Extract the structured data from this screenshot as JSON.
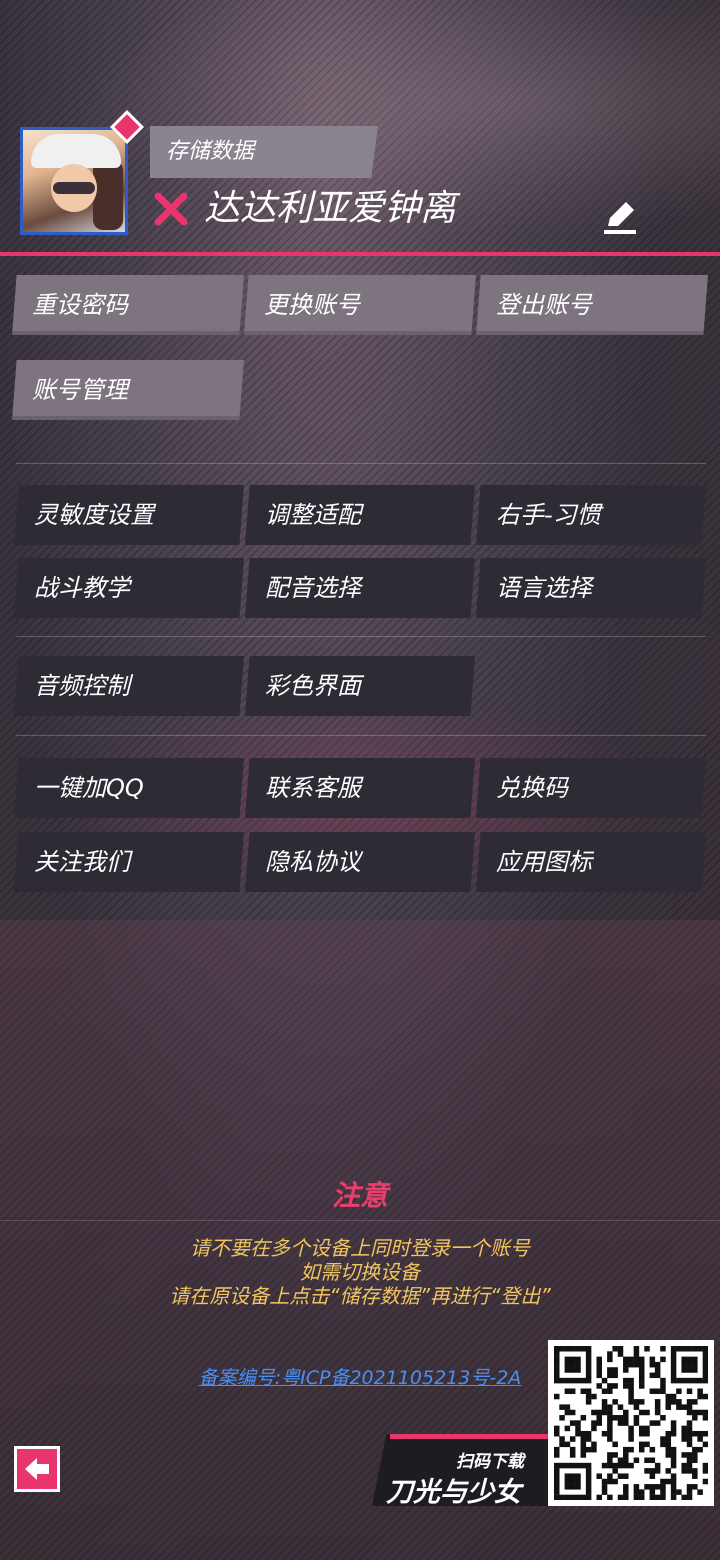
{
  "profile": {
    "save_label": "存储数据",
    "username": "达达利亚爱钟离"
  },
  "account_buttons": [
    {
      "label": "重设密码"
    },
    {
      "label": "更换账号"
    },
    {
      "label": "登出账号"
    },
    {
      "label": "账号管理"
    }
  ],
  "settings_buttons": [
    {
      "label": "灵敏度设置"
    },
    {
      "label": "调整适配"
    },
    {
      "label": "右手-习惯"
    },
    {
      "label": "战斗教学"
    },
    {
      "label": "配音选择"
    },
    {
      "label": "语言选择"
    }
  ],
  "audio_buttons": [
    {
      "label": "音频控制"
    },
    {
      "label": "彩色界面"
    }
  ],
  "social_buttons": [
    {
      "label": "一键加QQ"
    },
    {
      "label": "联系客服"
    },
    {
      "label": "兑换码"
    },
    {
      "label": "关注我们"
    },
    {
      "label": "隐私协议"
    },
    {
      "label": "应用图标"
    }
  ],
  "notice": {
    "title": "注意",
    "line1": "请不要在多个设备上同时登录一个账号",
    "line2": "如需切换设备",
    "line3": "请在原设备上点击“储存数据”再进行“登出”"
  },
  "icp": "备案编号:粤ICP备2021105213号-2A",
  "promo": {
    "small": "扫码下载",
    "big": "刀光与少女"
  },
  "colors": {
    "accent": "#e8356d",
    "notice_text": "#f0c560",
    "link": "#4a8ff0"
  }
}
